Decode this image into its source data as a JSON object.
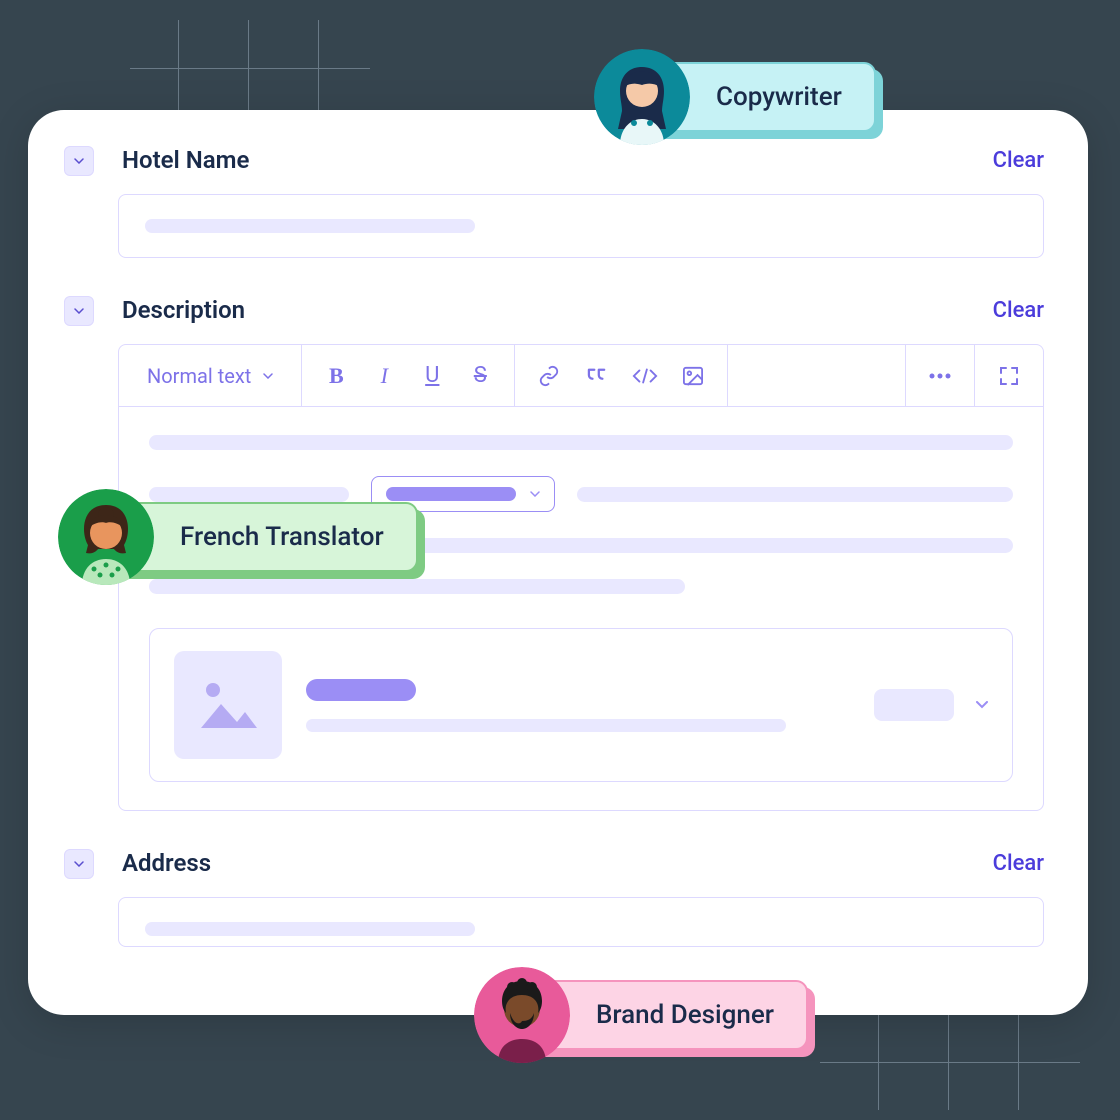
{
  "fields": {
    "hotel_name": {
      "label": "Hotel Name",
      "clear": "Clear"
    },
    "description": {
      "label": "Description",
      "clear": "Clear"
    },
    "address": {
      "label": "Address",
      "clear": "Clear"
    }
  },
  "toolbar": {
    "text_style": "Normal text"
  },
  "collaborators": {
    "copywriter": "Copywriter",
    "french_translator": "French Translator",
    "brand_designer": "Brand Designer"
  }
}
